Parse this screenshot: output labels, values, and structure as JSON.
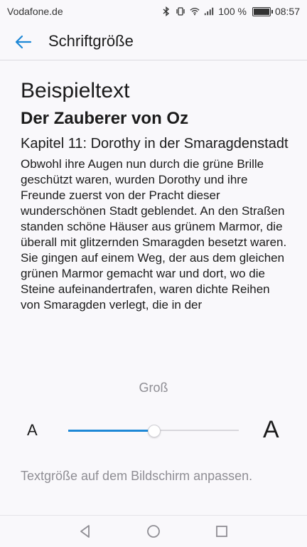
{
  "status_bar": {
    "carrier": "Vodafone.de",
    "battery_percent_text": "100 %",
    "battery_level": 1.0,
    "time": "08:57",
    "icons": [
      "bluetooth-icon",
      "vibrate-icon",
      "wifi-icon",
      "signal-icon",
      "battery-icon"
    ]
  },
  "app_bar": {
    "back_icon": "arrow-back-icon",
    "title": "Schriftgröße"
  },
  "preview": {
    "heading": "Beispieltext",
    "book_title": "Der Zauberer von Oz",
    "chapter": "Kapitel 11: Dorothy in der Smaragdenstadt",
    "body": "Obwohl ihre Augen nun durch die grüne Brille geschützt waren, wurden Dorothy und ihre Freunde zuerst von der Pracht dieser wunderschönen Stadt geblendet. An den Straßen standen schöne Häuser aus grünem Marmor, die überall mit glitzernden Smaragden besetzt waren. Sie gingen auf einem Weg, der aus dem gleichen grünen Marmor gemacht war und dort, wo die Steine aufeinandertrafen, waren dichte Reihen von Smaragden verlegt, die in der"
  },
  "font_size": {
    "current_label": "Groß",
    "small_glyph": "A",
    "large_glyph": "A",
    "slider_value_fraction": 0.5,
    "accent_color": "#1e88d6"
  },
  "description": "Textgröße auf dem Bildschirm anpassen.",
  "nav_bar": {
    "icons": [
      "back-triangle-icon",
      "home-circle-icon",
      "recents-square-icon"
    ]
  }
}
